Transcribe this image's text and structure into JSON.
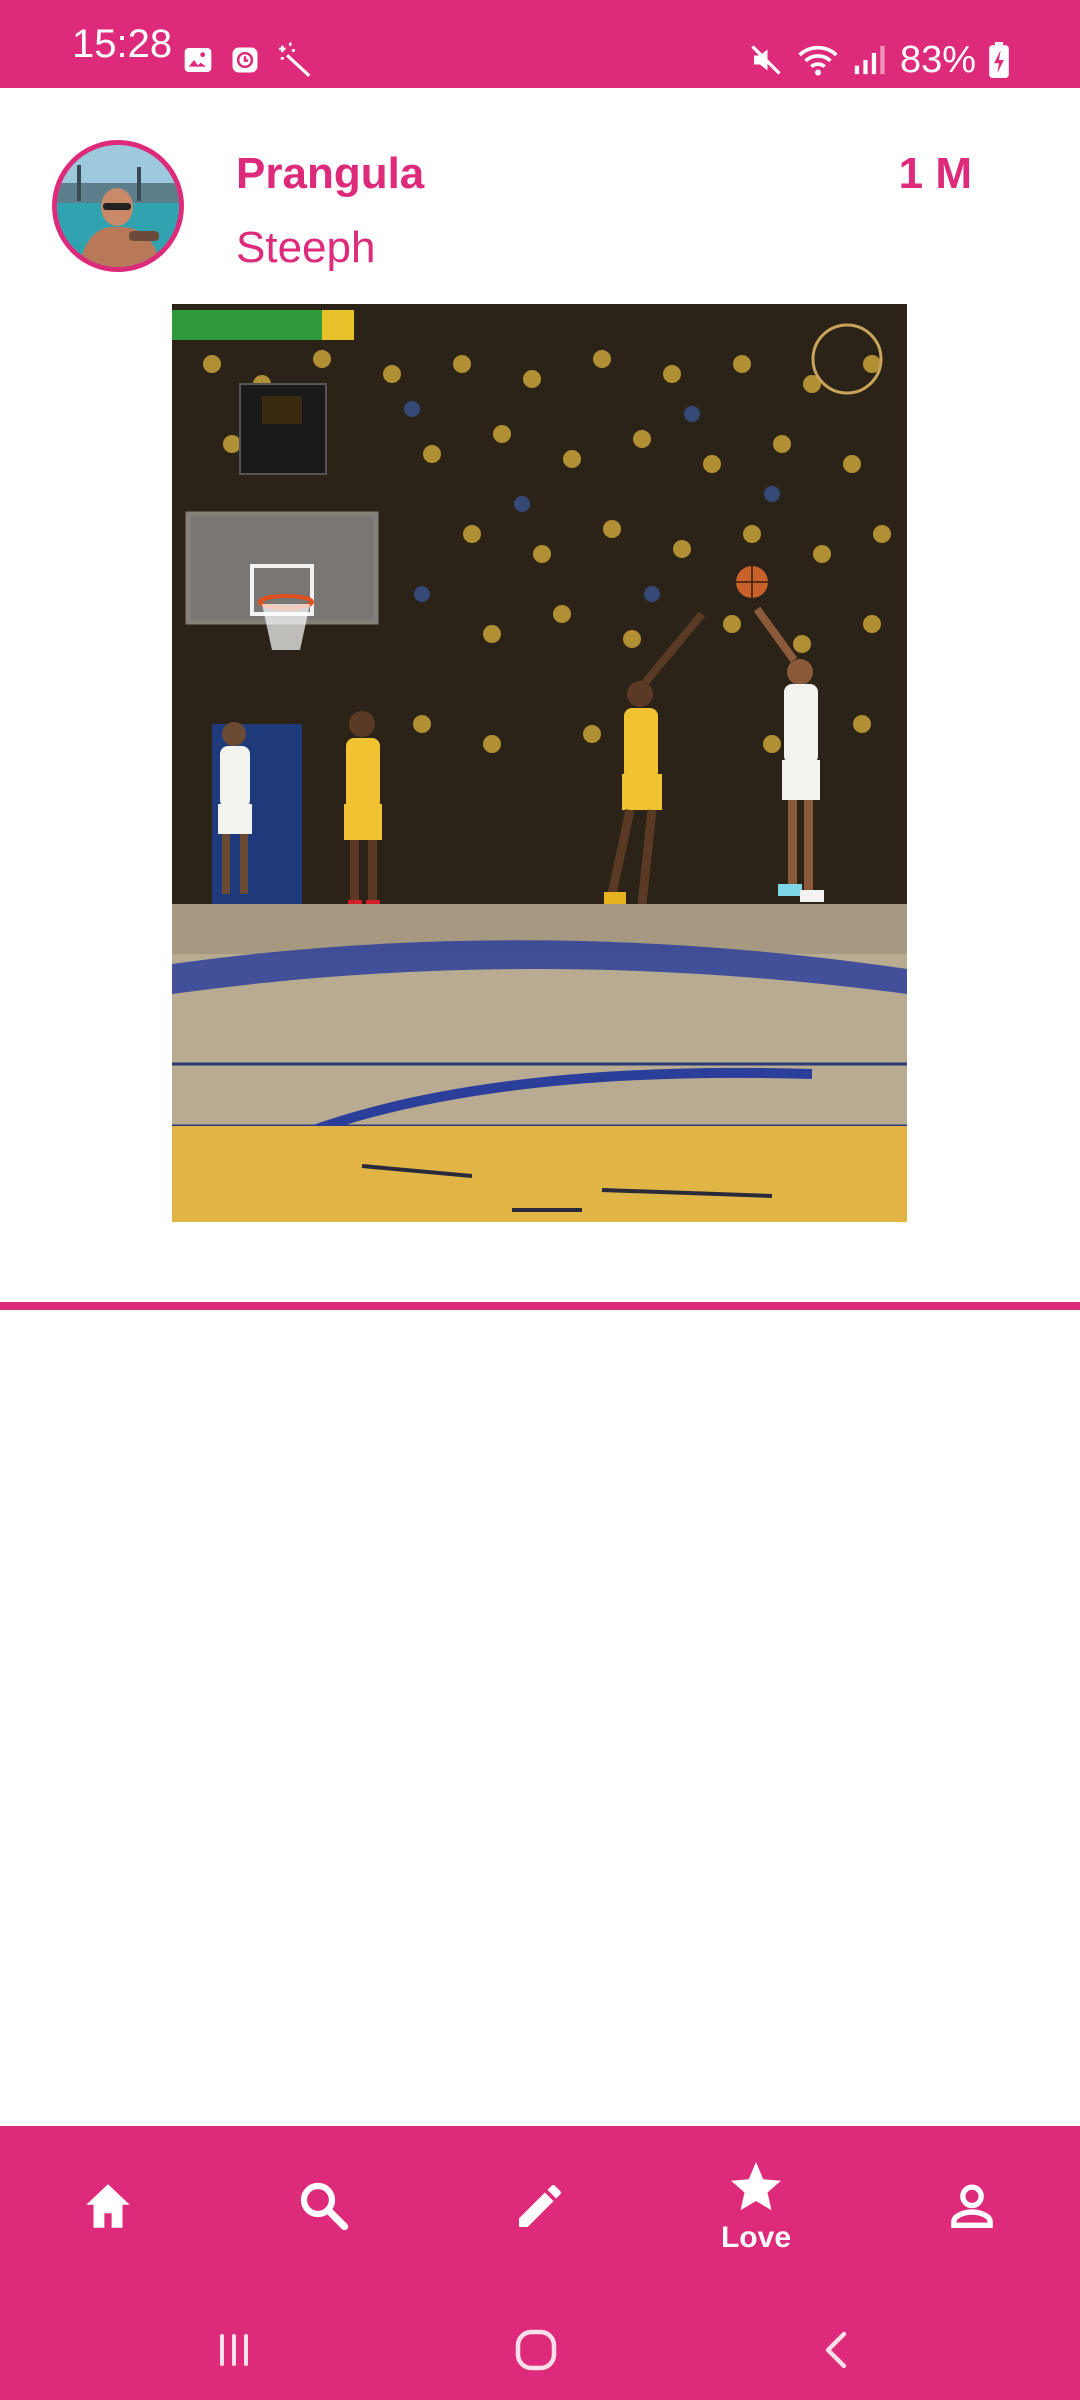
{
  "status_bar": {
    "time": "15:28",
    "battery": "83%",
    "left_icons": [
      "gallery-icon",
      "clock-app-icon",
      "magic-wand-icon"
    ],
    "right_icons": [
      "mute-icon",
      "wifi-icon",
      "signal-icon",
      "battery-charging-icon"
    ]
  },
  "post": {
    "username": "Prangula",
    "subtitle": "Steeph",
    "time": "1 M",
    "image": "basketball-game-photo"
  },
  "bottom_nav": {
    "items": [
      {
        "icon": "home-icon",
        "label": ""
      },
      {
        "icon": "search-icon",
        "label": ""
      },
      {
        "icon": "pencil-icon",
        "label": ""
      },
      {
        "icon": "star-icon",
        "label": "Love",
        "selected": true
      },
      {
        "icon": "person-icon",
        "label": ""
      }
    ]
  },
  "system_nav": [
    "recent-apps-icon",
    "home-circle-icon",
    "back-icon"
  ],
  "colors": {
    "accent": "#de2a7a",
    "background": "#ffffff",
    "on_accent": "#ffffff"
  }
}
